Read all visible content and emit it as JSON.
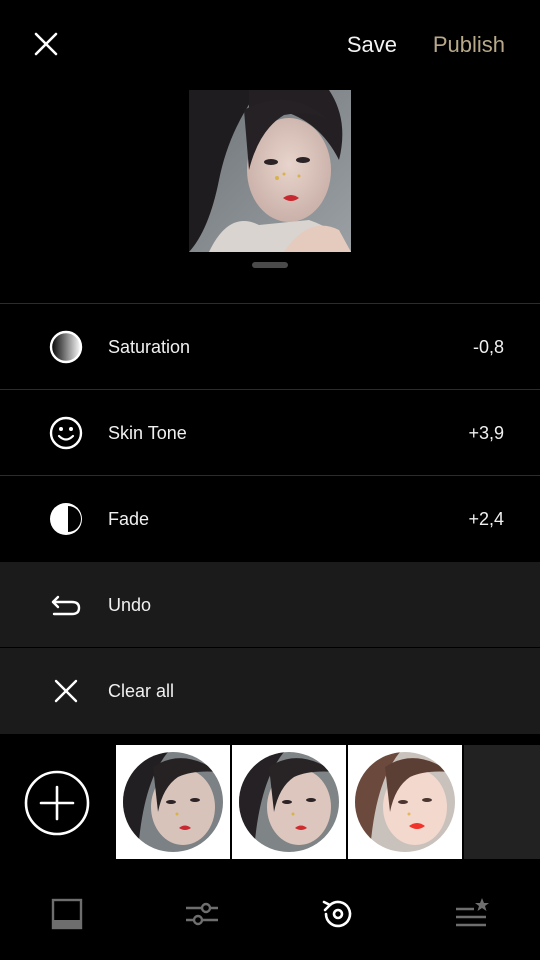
{
  "header": {
    "save_label": "Save",
    "publish_label": "Publish",
    "close_icon": "close-icon"
  },
  "preview": {
    "handle": "drag-handle"
  },
  "adjustments": [
    {
      "icon": "saturation-icon",
      "label": "Saturation",
      "value": "-0,8"
    },
    {
      "icon": "skin-tone-icon",
      "label": "Skin Tone",
      "value": "+3,9"
    },
    {
      "icon": "fade-icon",
      "label": "Fade",
      "value": "+2,4"
    }
  ],
  "actions": [
    {
      "icon": "undo-icon",
      "label": "Undo"
    },
    {
      "icon": "clear-icon",
      "label": "Clear all"
    }
  ],
  "filmstrip": {
    "add_icon": "add-icon",
    "thumbnail_count_visible": 3
  },
  "bottom_nav": [
    {
      "icon": "presets-icon",
      "active": false
    },
    {
      "icon": "adjust-sliders-icon",
      "active": false
    },
    {
      "icon": "history-icon",
      "active": true
    },
    {
      "icon": "recipes-icon",
      "active": false
    }
  ],
  "colors": {
    "background": "#000000",
    "panel_gray": "#1b1b1b",
    "publish_accent": "#b8a98a",
    "text": "#f0f0f0",
    "inactive_icon": "#6e6e6e"
  }
}
